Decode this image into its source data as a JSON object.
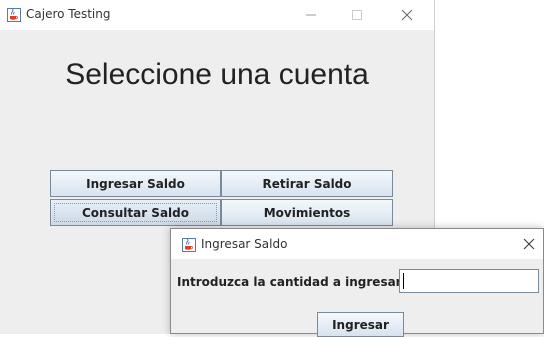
{
  "main_window": {
    "title": "Cajero Testing",
    "heading": "Seleccione una cuenta",
    "buttons": {
      "ingresar": "Ingresar Saldo",
      "retirar": "Retirar Saldo",
      "consultar": "Consultar Saldo",
      "movimientos": "Movimientos"
    }
  },
  "dialog": {
    "title": "Ingresar Saldo",
    "label": "Introduzca la cantidad a ingresar:",
    "input_value": "",
    "submit_label": "Ingresar"
  },
  "icons": {
    "app": "java-cup-icon",
    "minimize": "minimize-icon",
    "maximize": "maximize-icon",
    "close": "close-icon"
  },
  "colors": {
    "window_bg": "#eeeeee",
    "button_gradient_top": "#f4f8fc",
    "button_gradient_bottom": "#d7e3ef",
    "button_border": "#7a8a99"
  }
}
